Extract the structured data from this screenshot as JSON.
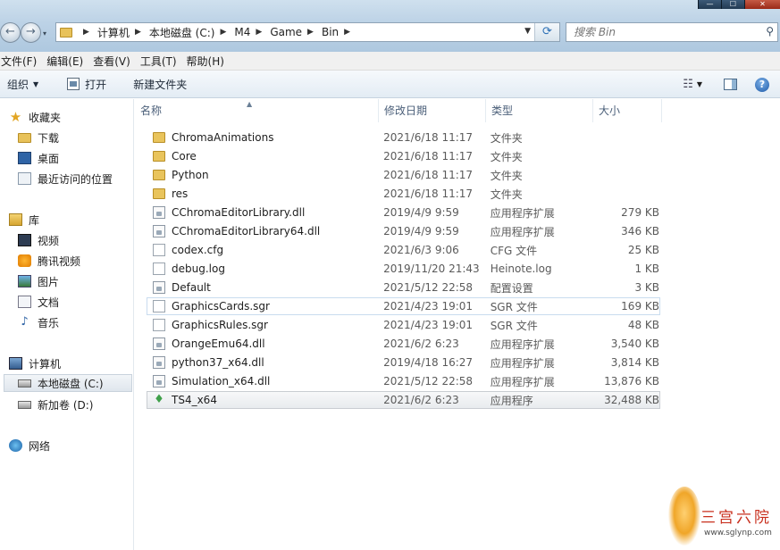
{
  "window": {
    "caption_min": "—",
    "caption_max": "☐",
    "caption_close": "✕"
  },
  "nav": {
    "back_glyph": "←",
    "forward_glyph": "→",
    "history_glyph": "▾"
  },
  "address": {
    "crumbs": [
      "计算机",
      "本地磁盘 (C:)",
      "M4",
      "Game",
      "Bin"
    ],
    "separator": "▶",
    "dropdown_glyph": "▼",
    "refresh_glyph": "⟳"
  },
  "search": {
    "placeholder": "搜索 Bin",
    "icon_glyph": "⚲"
  },
  "menu": [
    "文件(F)",
    "编辑(E)",
    "查看(V)",
    "工具(T)",
    "帮助(H)"
  ],
  "toolbar": {
    "organize": "组织",
    "organize_arrow": "▼",
    "open": "打开",
    "new_folder": "新建文件夹",
    "view_glyph": "☷",
    "view_arrow": "▼",
    "help_glyph": "?"
  },
  "sidebar": {
    "favorites": "收藏夹",
    "downloads": "下载",
    "desktop": "桌面",
    "recent": "最近访问的位置",
    "libraries": "库",
    "videos": "视频",
    "tencent_video": "腾讯视频",
    "pictures": "图片",
    "documents": "文档",
    "music": "音乐",
    "computer": "计算机",
    "local_disk_c": "本地磁盘 (C:)",
    "volume_d": "新加卷 (D:)",
    "network": "网络",
    "star_glyph": "★",
    "music_glyph": "♪"
  },
  "columns": {
    "name": "名称",
    "date": "修改日期",
    "type": "类型",
    "size": "大小",
    "sort_glyph": "▲"
  },
  "files": [
    {
      "name": "ChromaAnimations",
      "date": "2021/6/18 11:17",
      "type": "文件夹",
      "size": "",
      "icon": "folder-icon"
    },
    {
      "name": "Core",
      "date": "2021/6/18 11:17",
      "type": "文件夹",
      "size": "",
      "icon": "folder-icon"
    },
    {
      "name": "Python",
      "date": "2021/6/18 11:17",
      "type": "文件夹",
      "size": "",
      "icon": "folder-icon"
    },
    {
      "name": "res",
      "date": "2021/6/18 11:17",
      "type": "文件夹",
      "size": "",
      "icon": "folder-icon"
    },
    {
      "name": "CChromaEditorLibrary.dll",
      "date": "2019/4/9 9:59",
      "type": "应用程序扩展",
      "size": "279 KB",
      "icon": "dll-icon"
    },
    {
      "name": "CChromaEditorLibrary64.dll",
      "date": "2019/4/9 9:59",
      "type": "应用程序扩展",
      "size": "346 KB",
      "icon": "dll-icon"
    },
    {
      "name": "codex.cfg",
      "date": "2021/6/3 9:06",
      "type": "CFG 文件",
      "size": "25 KB",
      "icon": "file-icon"
    },
    {
      "name": "debug.log",
      "date": "2019/11/20 21:43",
      "type": "Heinote.log",
      "size": "1 KB",
      "icon": "file-icon"
    },
    {
      "name": "Default",
      "date": "2021/5/12 22:58",
      "type": "配置设置",
      "size": "3 KB",
      "icon": "settings-file-icon"
    },
    {
      "name": "GraphicsCards.sgr",
      "date": "2021/4/23 19:01",
      "type": "SGR 文件",
      "size": "169 KB",
      "icon": "file-icon"
    },
    {
      "name": "GraphicsRules.sgr",
      "date": "2021/4/23 19:01",
      "type": "SGR 文件",
      "size": "48 KB",
      "icon": "file-icon"
    },
    {
      "name": "OrangeEmu64.dll",
      "date": "2021/6/2 6:23",
      "type": "应用程序扩展",
      "size": "3,540 KB",
      "icon": "dll-icon"
    },
    {
      "name": "python37_x64.dll",
      "date": "2019/4/18 16:27",
      "type": "应用程序扩展",
      "size": "3,814 KB",
      "icon": "dll-icon"
    },
    {
      "name": "Simulation_x64.dll",
      "date": "2021/5/12 22:58",
      "type": "应用程序扩展",
      "size": "13,876 KB",
      "icon": "dll-icon"
    },
    {
      "name": "TS4_x64",
      "date": "2021/6/2 6:23",
      "type": "应用程序",
      "size": "32,488 KB",
      "icon": "plumbob-exe-icon"
    }
  ],
  "watermark": {
    "text": "三宫六院",
    "url": "www.sglynp.com"
  }
}
